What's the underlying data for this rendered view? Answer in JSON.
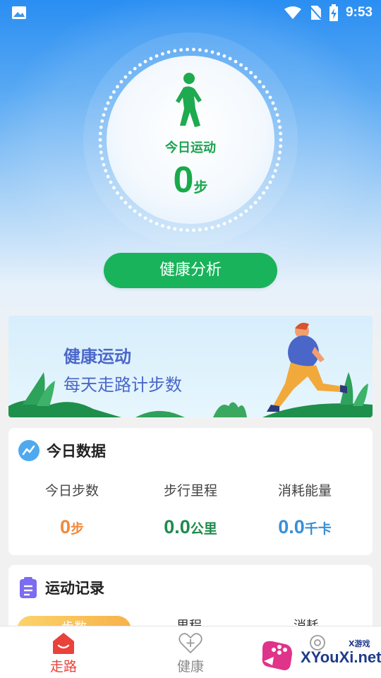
{
  "status_bar": {
    "time": "9:53"
  },
  "hero": {
    "today_label": "今日运动",
    "steps_value": "0",
    "steps_unit": "步",
    "analysis_button": "健康分析"
  },
  "banner": {
    "title": "健康运动",
    "subtitle": "每天走路计步数"
  },
  "today_data": {
    "title": "今日数据",
    "stats": [
      {
        "label": "今日步数",
        "value": "0",
        "unit": "步",
        "color": "#f08a3c"
      },
      {
        "label": "步行里程",
        "value": "0.0",
        "unit": "公里",
        "color": "#1f8a4c"
      },
      {
        "label": "消耗能量",
        "value": "0.0",
        "unit": "千卡",
        "color": "#3a8fd6"
      }
    ]
  },
  "records": {
    "title": "运动记录",
    "tabs": [
      "步数",
      "里程",
      "消耗"
    ]
  },
  "bottom_nav": {
    "items": [
      {
        "label": "走路",
        "icon": "home-icon",
        "active": true
      },
      {
        "label": "健康",
        "icon": "heart-plus-icon",
        "active": false
      },
      {
        "label": "",
        "icon": "gear-icon",
        "active": false
      }
    ]
  },
  "watermark": {
    "brand": "XYouXi.net",
    "small": "X游戏"
  },
  "colors": {
    "primary_green": "#18b35a",
    "active_nav": "#e8423b",
    "hero_blue": "#2a8ef2"
  }
}
